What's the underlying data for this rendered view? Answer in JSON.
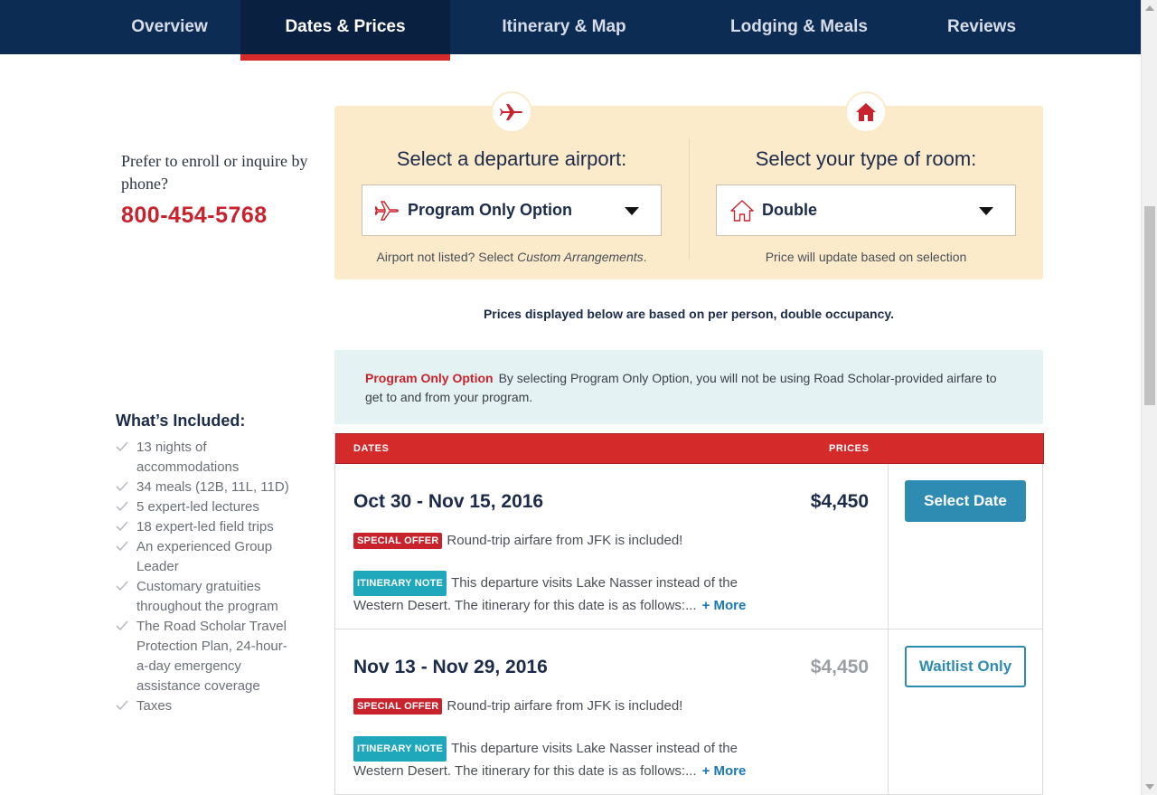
{
  "nav": {
    "tabs": [
      {
        "label": "Overview"
      },
      {
        "label": "Dates & Prices"
      },
      {
        "label": "Itinerary & Map"
      },
      {
        "label": "Lodging & Meals"
      },
      {
        "label": "Reviews"
      }
    ],
    "active_tab": "Dates & Prices"
  },
  "phone": {
    "prompt": "Prefer to enroll or inquire by phone?",
    "number": "800-454-5768"
  },
  "included": {
    "title": "What’s Included:",
    "items": [
      "13 nights of accommodations",
      "34 meals (12B, 11L, 11D)",
      "5 expert-led lectures",
      "18 expert-led field trips",
      "An experienced Group Leader",
      "Customary gratuities throughout the program",
      "The Road Scholar Travel Protection Plan, 24-hour-a-day emergency assistance coverage",
      "Taxes"
    ]
  },
  "selectors": {
    "airport": {
      "title": "Select a departure airport:",
      "value": "Program Only Option",
      "note_prefix": "Airport not listed? Select ",
      "note_emphasis": "Custom Arrangements",
      "note_suffix": ".",
      "icon": "airplane-icon"
    },
    "room": {
      "title": "Select your type of room:",
      "value": "Double",
      "note": "Price will update based on selection",
      "icon": "house-icon"
    }
  },
  "occupancy_note": "Prices displayed below are based on per person, double occupancy.",
  "info": {
    "option_name": "Program Only Option",
    "text": "By selecting Program Only Option, you will not be using Road Scholar-provided airfare to get to and from your program."
  },
  "table": {
    "header_dates": "DATES",
    "header_prices": "PRICES",
    "rows": [
      {
        "date": "Oct 30 - Nov 15, 2016",
        "price": "$4,450",
        "offer_tag": "SPECIAL OFFER",
        "offer_text": "Round-trip airfare from JFK is included!",
        "note_tag": "ITINERARY NOTE",
        "note_text": "This departure visits Lake Nasser instead of the Western Desert. The itinerary for this date is as follows:...",
        "more": "+ More",
        "button": "Select Date"
      },
      {
        "date": "Nov 13 - Nov 29, 2016",
        "price": "$4,450",
        "offer_tag": "SPECIAL OFFER",
        "offer_text": "Round-trip airfare from JFK is included!",
        "note_tag": "ITINERARY NOTE",
        "note_text": "This departure visits Lake Nasser instead of the Western Desert. The itinerary for this date is as follows:...",
        "more": "+ More",
        "button": "Waitlist Only"
      }
    ]
  },
  "colors": {
    "nav_bg": "#0d2c54",
    "accent_red": "#c8232c",
    "button_blue": "#2e8cb3",
    "panel_bg": "#fcebcb",
    "info_bg": "#e5f2f4",
    "tag_teal": "#1fa8bc"
  }
}
